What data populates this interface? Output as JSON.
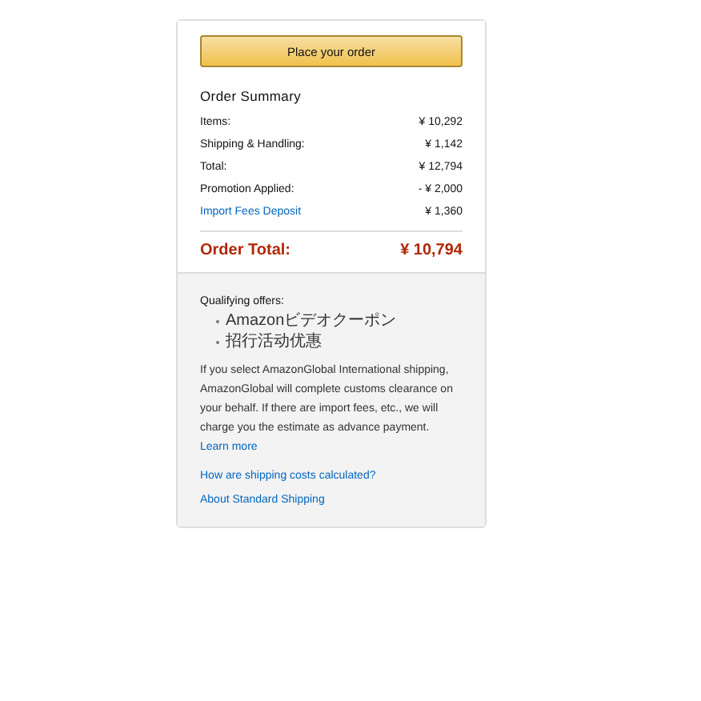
{
  "place_order_button": "Place your order",
  "order_summary": {
    "title": "Order Summary",
    "rows": [
      {
        "kind": "plain",
        "label": "Items:",
        "value": "¥ 10,292"
      },
      {
        "kind": "plain",
        "label": "Shipping & Handling:",
        "value": "¥ 1,142"
      },
      {
        "kind": "plain",
        "label": "Total:",
        "value": "¥ 12,794"
      },
      {
        "kind": "plain",
        "label": "Promotion Applied:",
        "value": "- ¥ 2,000"
      },
      {
        "kind": "link",
        "label": "Import Fees Deposit",
        "value": "¥ 1,360"
      }
    ],
    "order_total": {
      "label": "Order Total:",
      "value": "¥ 10,794"
    }
  },
  "offers": {
    "title": "Qualifying offers:",
    "items": [
      "Amazonビデオクーポン",
      "招行活动优惠"
    ]
  },
  "notice": {
    "text": "If you select AmazonGlobal International shipping, AmazonGlobal will complete customs clearance on your behalf. If there are import fees, etc., we will charge you the estimate as advance payment.",
    "link": "Learn more"
  },
  "links": [
    "How are shipping costs calculated?",
    "About Standard Shipping"
  ]
}
